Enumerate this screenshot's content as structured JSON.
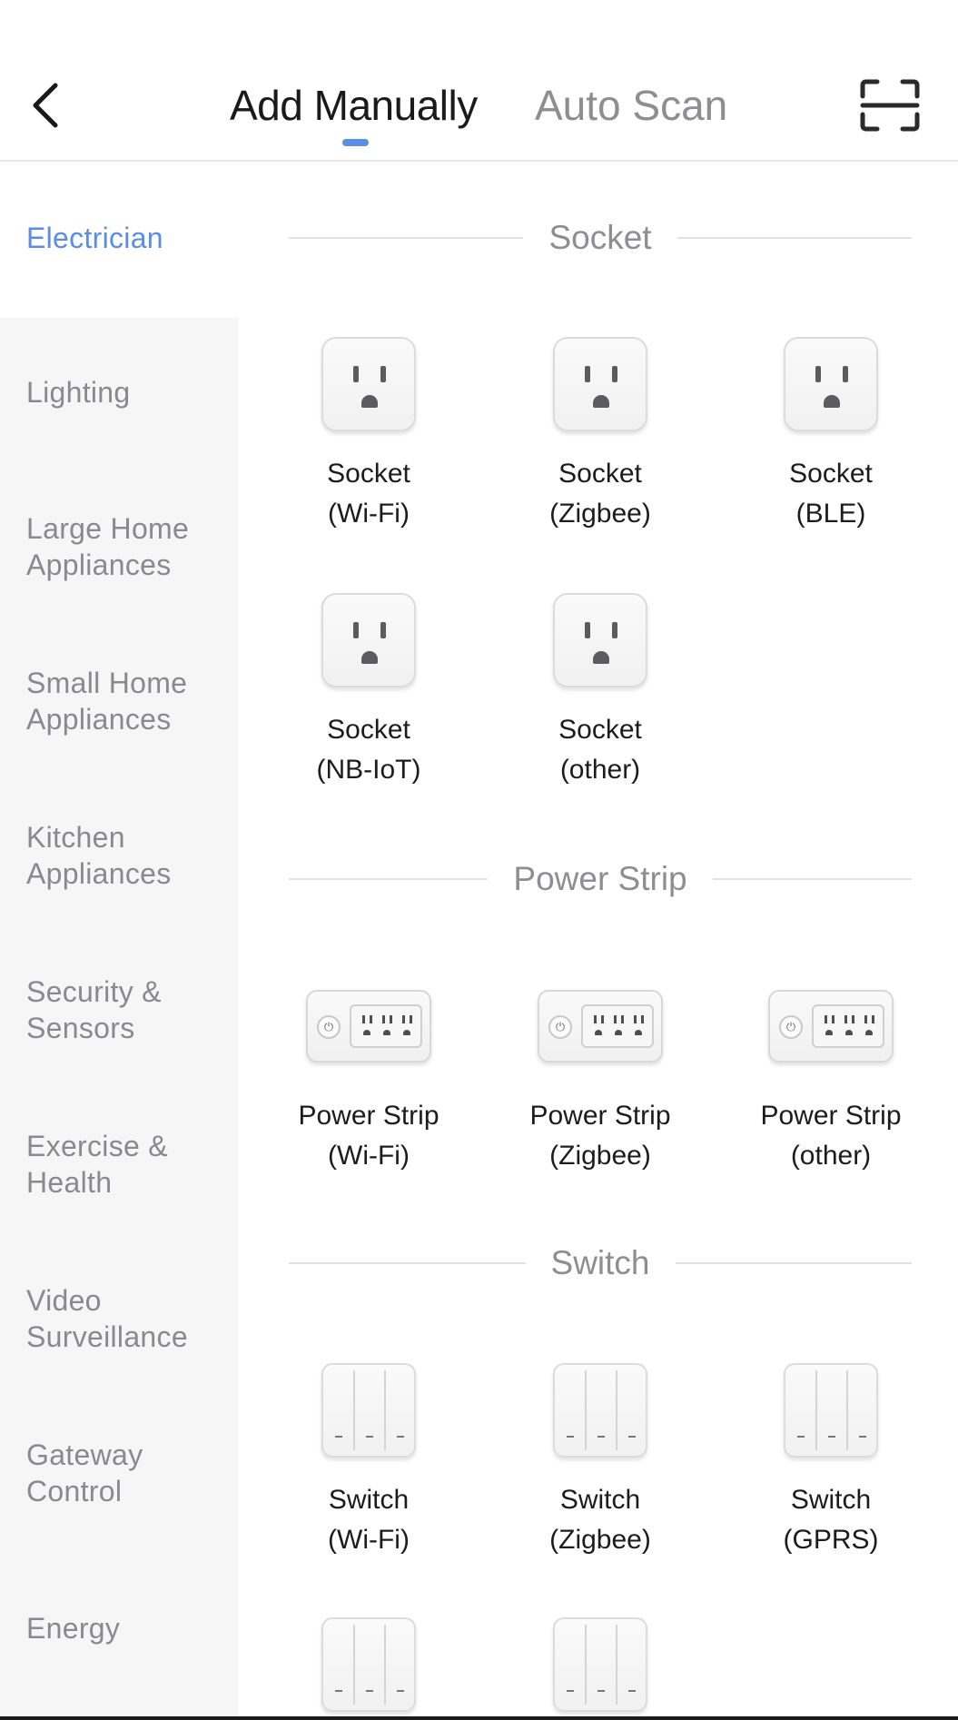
{
  "header": {
    "back_icon": "chevron-left-icon",
    "tabs": [
      {
        "label": "Add Manually",
        "active": true
      },
      {
        "label": "Auto Scan",
        "active": false
      }
    ],
    "scan_icon": "scan-frame-icon",
    "accent_color": "#5a8ee6"
  },
  "sidebar": {
    "categories": [
      {
        "label": "Electrician",
        "active": true
      },
      {
        "label": "Lighting"
      },
      {
        "label": "Large Home Appliances"
      },
      {
        "label": "Small Home Appliances"
      },
      {
        "label": "Kitchen Appliances"
      },
      {
        "label": "Security & Sensors"
      },
      {
        "label": "Exercise & Health"
      },
      {
        "label": "Video Surveillance"
      },
      {
        "label": "Gateway Control"
      },
      {
        "label": "Energy"
      }
    ]
  },
  "sections": [
    {
      "title": "Socket",
      "icon": "socket-icon",
      "items": [
        {
          "line1": "Socket",
          "line2": "(Wi-Fi)"
        },
        {
          "line1": "Socket",
          "line2": "(Zigbee)"
        },
        {
          "line1": "Socket",
          "line2": "(BLE)"
        },
        {
          "line1": "Socket",
          "line2": "(NB-IoT)"
        },
        {
          "line1": "Socket",
          "line2": "(other)"
        }
      ]
    },
    {
      "title": "Power Strip",
      "icon": "power-strip-icon",
      "items": [
        {
          "line1": "Power Strip",
          "line2": "(Wi-Fi)"
        },
        {
          "line1": "Power Strip",
          "line2": "(Zigbee)"
        },
        {
          "line1": "Power Strip",
          "line2": "(other)"
        }
      ]
    },
    {
      "title": "Switch",
      "icon": "switch-icon",
      "items": [
        {
          "line1": "Switch",
          "line2": "(Wi-Fi)"
        },
        {
          "line1": "Switch",
          "line2": "(Zigbee)"
        },
        {
          "line1": "Switch",
          "line2": "(GPRS)"
        },
        {
          "line1": "",
          "line2": ""
        },
        {
          "line1": "",
          "line2": ""
        }
      ]
    }
  ]
}
